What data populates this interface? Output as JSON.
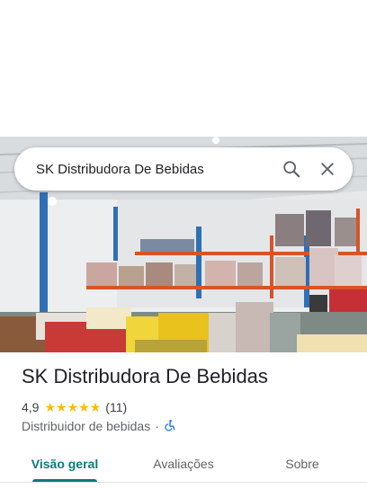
{
  "search": {
    "query": "SK Distribudora De Bebidas",
    "search_icon": "search-icon",
    "close_icon": "close-icon"
  },
  "place": {
    "name": "SK Distribudora De Bebidas",
    "rating": "4,9",
    "stars": 5,
    "review_count": "(11)",
    "category": "Distribuidor de bebidas",
    "separator": "·",
    "accessibility_icon": "wheelchair-icon"
  },
  "tabs": [
    {
      "label": "Visão geral",
      "active": true
    },
    {
      "label": "Avaliações",
      "active": false
    },
    {
      "label": "Sobre",
      "active": false
    }
  ],
  "colors": {
    "accent": "#0b7a7a",
    "star": "#fbbc04",
    "accessibility": "#1a73e8"
  }
}
